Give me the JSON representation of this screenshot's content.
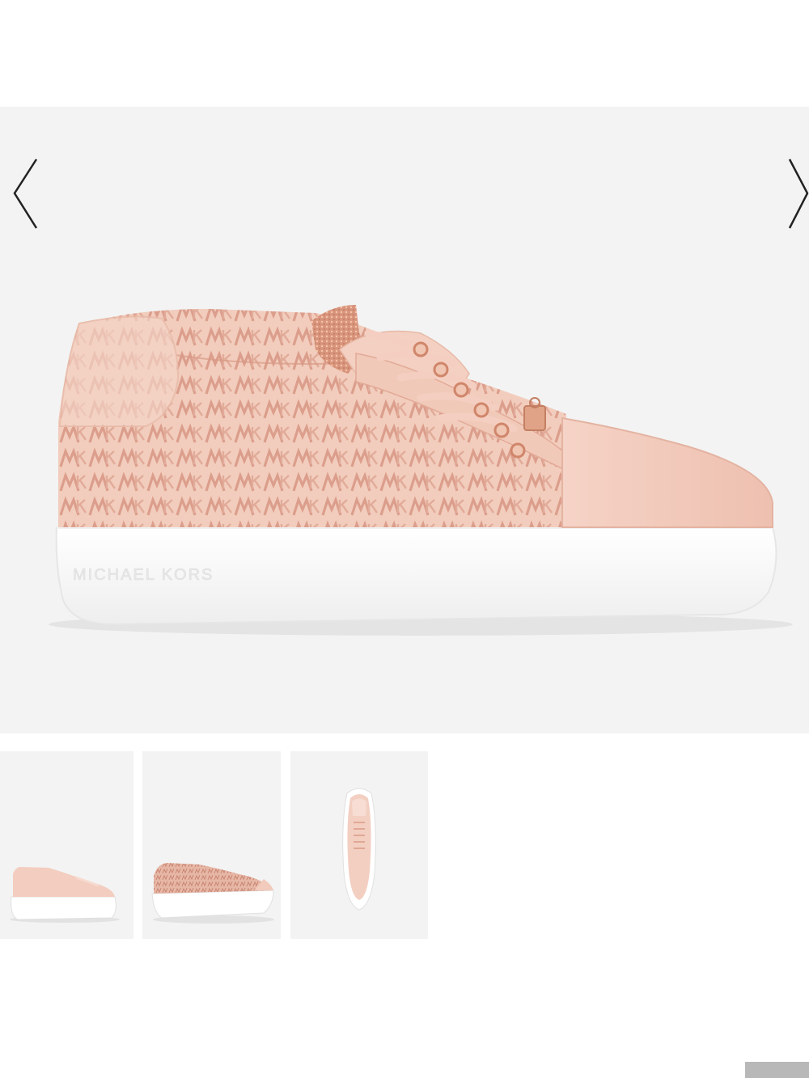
{
  "gallery": {
    "prev_icon": "chevron-left-icon",
    "next_icon": "chevron-right-icon",
    "main_image": {
      "description_icon": "sneaker-image",
      "sole_brand_text": "MICHAEL KORS"
    },
    "thumbnails": [
      {
        "icon": "sneaker-thumbnail-side"
      },
      {
        "icon": "sneaker-thumbnail-angle"
      },
      {
        "icon": "sneaker-thumbnail-top"
      }
    ]
  },
  "colors": {
    "background": "#f3f3f3",
    "upper": "#f0c9b8",
    "monogram": "#d99b8a",
    "toe": "#f4cfc2",
    "sole": "#ffffff",
    "hardware": "#d8937a",
    "arrow": "#222222"
  }
}
